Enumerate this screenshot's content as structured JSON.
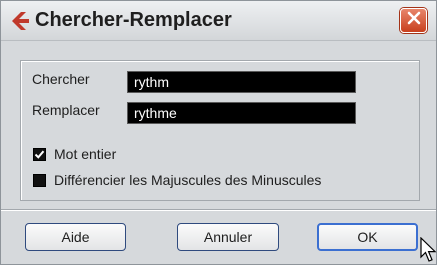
{
  "window": {
    "title": "Chercher-Remplacer"
  },
  "fields": {
    "find_label": "Chercher",
    "find_value": "rythm",
    "replace_label": "Remplacer",
    "replace_value": "rythme"
  },
  "options": [
    {
      "label": "Mot entier",
      "checked": true
    },
    {
      "label": "Différencier les Majuscules des Minuscules",
      "checked": false
    }
  ],
  "buttons": {
    "help": "Aide",
    "cancel": "Annuler",
    "ok": "OK"
  },
  "colors": {
    "accent": "#3b6fd1",
    "close": "#c83f1d",
    "app_icon": "#c0392b"
  }
}
